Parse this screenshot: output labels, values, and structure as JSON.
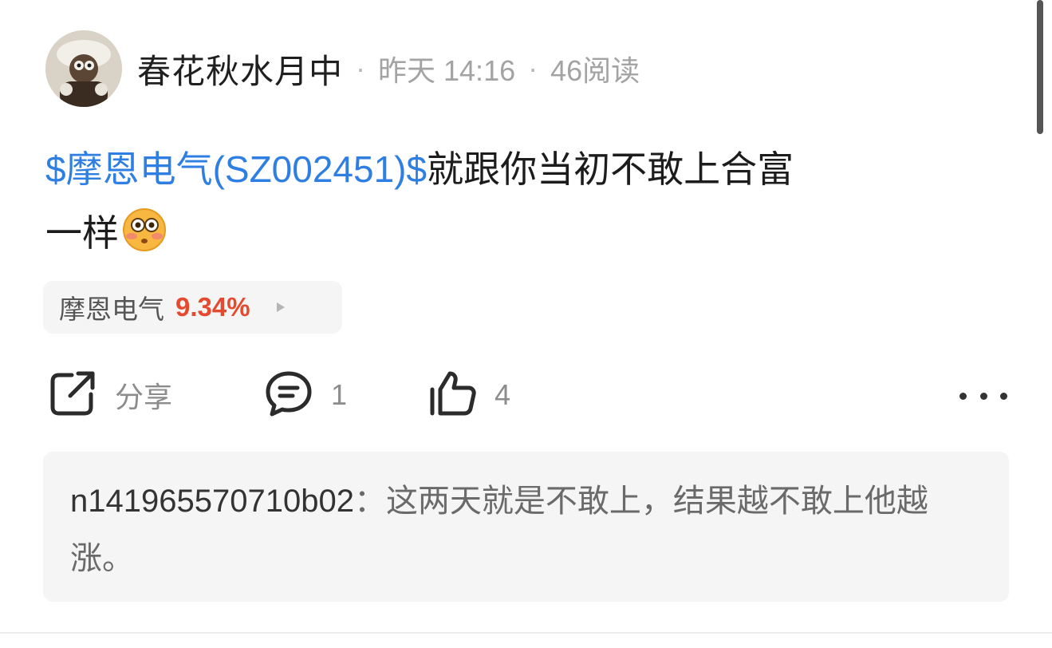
{
  "post": {
    "author": "春花秋水月中",
    "time": "昨天 14:16",
    "reads": "46阅读",
    "separator": "·",
    "stock_link": "$摩恩电气(SZ002451)$",
    "text_part1": "就跟你当初不敢上合富",
    "text_part2": "一样",
    "emoji": "flushed-face-emoji"
  },
  "stock_chip": {
    "name": "摩恩电气",
    "change": "9.34%",
    "icon": "play-arrow-icon"
  },
  "actions": {
    "share_label": "分享",
    "comment_count": "1",
    "like_count": "4",
    "icons": [
      "share-icon",
      "comment-icon",
      "thumbs-up-icon",
      "more-icon"
    ]
  },
  "comment": {
    "user": "n141965570710b02",
    "colon": "：",
    "text": "这两天就是不敢上，结果越不敢上他越涨。"
  },
  "colors": {
    "link": "#2f7fe3",
    "rise": "#e64a2e",
    "muted": "#a3a3a3",
    "chip_bg": "#f5f5f6"
  }
}
